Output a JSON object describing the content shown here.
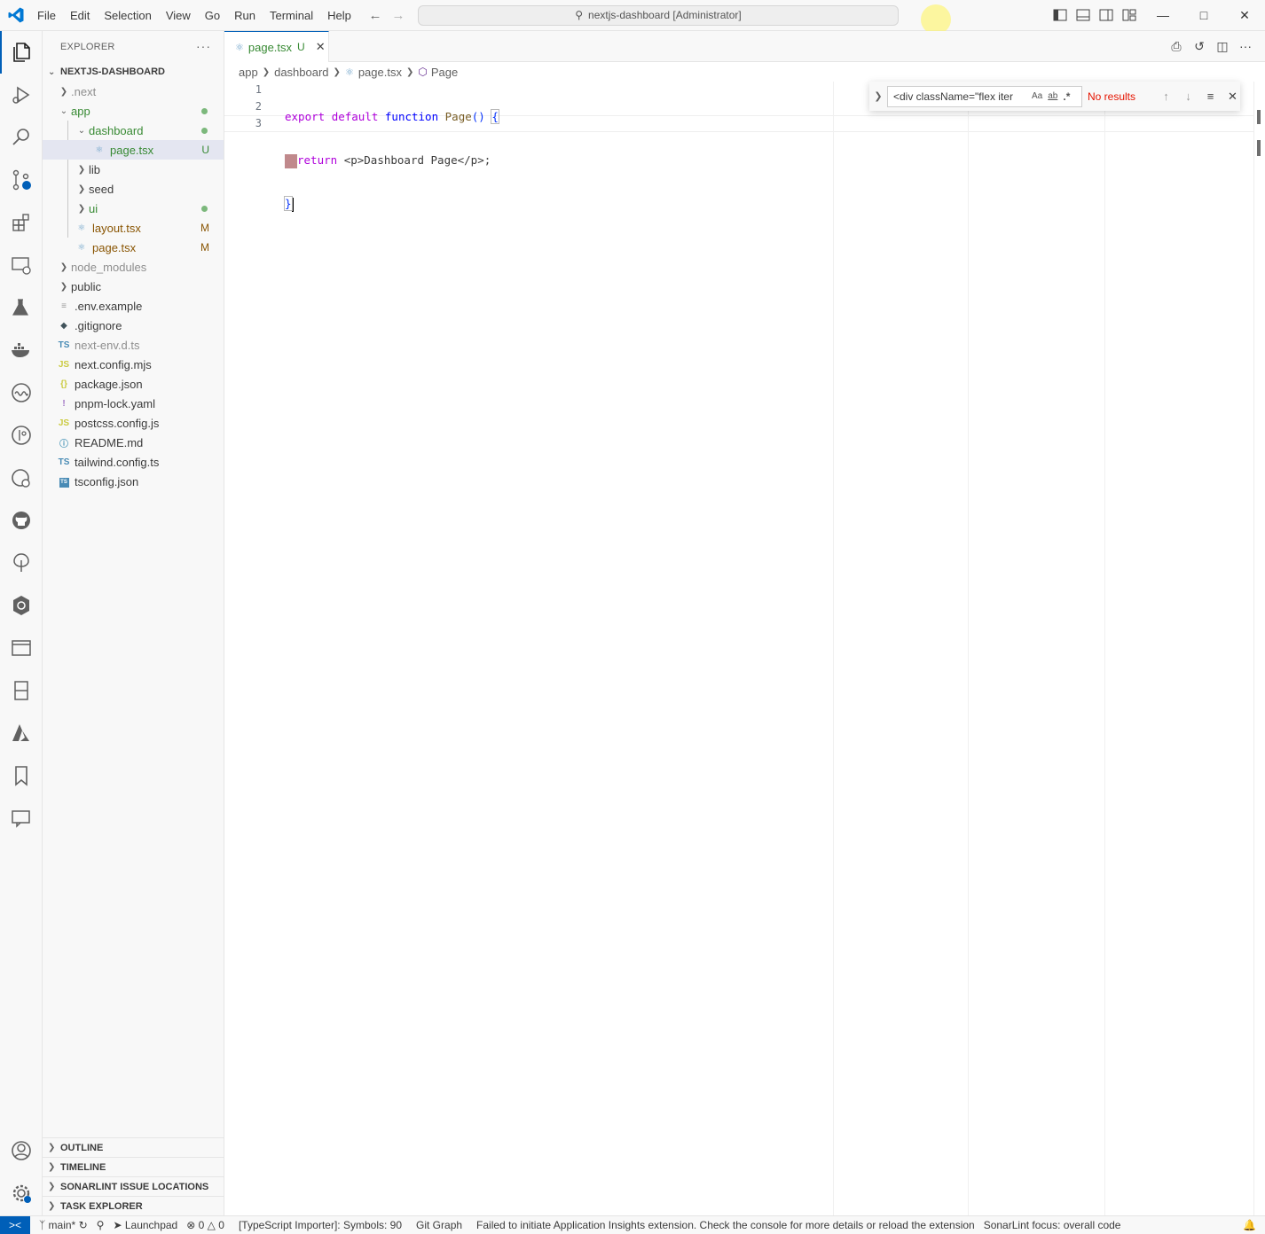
{
  "title": {
    "command_center": "nextjs-dashboard [Administrator]",
    "menu": [
      "File",
      "Edit",
      "Selection",
      "View",
      "Go",
      "Run",
      "Terminal",
      "Help"
    ]
  },
  "explorer": {
    "header": "EXPLORER",
    "root": "NEXTJS-DASHBOARD",
    "items": [
      {
        "label": ".next",
        "kind": "folder",
        "status": ""
      },
      {
        "label": "app",
        "kind": "folder-open",
        "status": "dot"
      },
      {
        "label": "dashboard",
        "kind": "folder-open",
        "status": "dot"
      },
      {
        "label": "page.tsx",
        "kind": "react",
        "status": "U"
      },
      {
        "label": "lib",
        "kind": "folder",
        "status": ""
      },
      {
        "label": "seed",
        "kind": "folder",
        "status": ""
      },
      {
        "label": "ui",
        "kind": "folder",
        "status": "dot"
      },
      {
        "label": "layout.tsx",
        "kind": "react",
        "status": "M"
      },
      {
        "label": "page.tsx",
        "kind": "react",
        "status": "M"
      },
      {
        "label": "node_modules",
        "kind": "folder",
        "status": ""
      },
      {
        "label": "public",
        "kind": "folder",
        "status": ""
      },
      {
        "label": ".env.example",
        "kind": "env",
        "status": ""
      },
      {
        "label": ".gitignore",
        "kind": "git",
        "status": ""
      },
      {
        "label": "next-env.d.ts",
        "kind": "ts",
        "status": ""
      },
      {
        "label": "next.config.mjs",
        "kind": "js",
        "status": ""
      },
      {
        "label": "package.json",
        "kind": "json",
        "status": ""
      },
      {
        "label": "pnpm-lock.yaml",
        "kind": "yaml",
        "status": ""
      },
      {
        "label": "postcss.config.js",
        "kind": "js",
        "status": ""
      },
      {
        "label": "README.md",
        "kind": "info",
        "status": ""
      },
      {
        "label": "tailwind.config.ts",
        "kind": "ts",
        "status": ""
      },
      {
        "label": "tsconfig.json",
        "kind": "tsconfig",
        "status": ""
      }
    ],
    "panes": [
      "OUTLINE",
      "TIMELINE",
      "SONARLINT ISSUE LOCATIONS",
      "TASK EXPLORER"
    ]
  },
  "editor": {
    "tab": {
      "label": "page.tsx",
      "status": "U"
    },
    "breadcrumb": [
      "app",
      "dashboard",
      "page.tsx",
      "Page"
    ],
    "line_numbers": [
      "1",
      "2",
      "3"
    ],
    "code": {
      "l1_export": "export",
      "l1_default": "default",
      "l1_function": "function",
      "l1_name": "Page",
      "l1_paren": "()",
      "l1_brace": "{",
      "l2_return": "return",
      "l2_rest": "<p>Dashboard Page</p>;",
      "l3_brace": "}"
    }
  },
  "find": {
    "value": "<div className=\"flex iter",
    "opt_case": "Aa",
    "opt_word": "ab",
    "opt_regex": ".*",
    "result": "No results"
  },
  "status": {
    "remote": "><",
    "branch": "main*",
    "launchpad": "Launchpad",
    "errors": "0",
    "warnings": "0",
    "ts_importer": "[TypeScript Importer]: Symbols: 90",
    "git_graph": "Git Graph",
    "message": "Failed to initiate Application Insights extension. Check the console for more details or reload the extension",
    "sonarlint": "SonarLint focus: overall code"
  },
  "colors": {
    "accent": "#005fb8",
    "untracked": "#388a34",
    "modified": "#895503",
    "error_text": "#e51400"
  }
}
